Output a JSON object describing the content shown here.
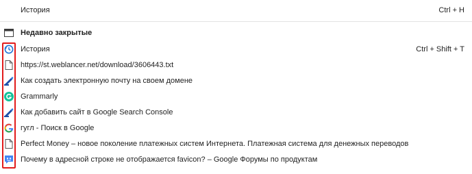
{
  "history_row": {
    "label": "История",
    "shortcut": "Ctrl + H"
  },
  "recently_closed": {
    "title": "Недавно закрытые",
    "title_icon": "tab-window-icon",
    "items": [
      {
        "label": "История",
        "shortcut": "Ctrl + Shift + T",
        "icon": "history-clock-icon"
      },
      {
        "label": "https://st.weblancer.net/download/3606443.txt",
        "shortcut": "",
        "icon": "blank-page-icon"
      },
      {
        "label": "Как создать электронную почту на своем домене",
        "shortcut": "",
        "icon": "pen-favicon-icon"
      },
      {
        "label": "Grammarly",
        "shortcut": "",
        "icon": "grammarly-icon"
      },
      {
        "label": "Как добавить сайт в Google Search Console",
        "shortcut": "",
        "icon": "pen-favicon-icon"
      },
      {
        "label": "гугл - Поиск в Google",
        "shortcut": "",
        "icon": "google-g-icon"
      },
      {
        "label": "Perfect Money – новое поколение платежных систем Интернета. Платежная система для денежных переводов",
        "shortcut": "",
        "icon": "blank-page-icon"
      },
      {
        "label": "Почему в адресной строке не отображается favicon? – Google Форумы по продуктам",
        "shortcut": "",
        "icon": "google-forum-icon"
      }
    ]
  },
  "colors": {
    "highlight": "#e11b1b",
    "text": "#1f1f1f",
    "divider": "#e3e3e3"
  }
}
